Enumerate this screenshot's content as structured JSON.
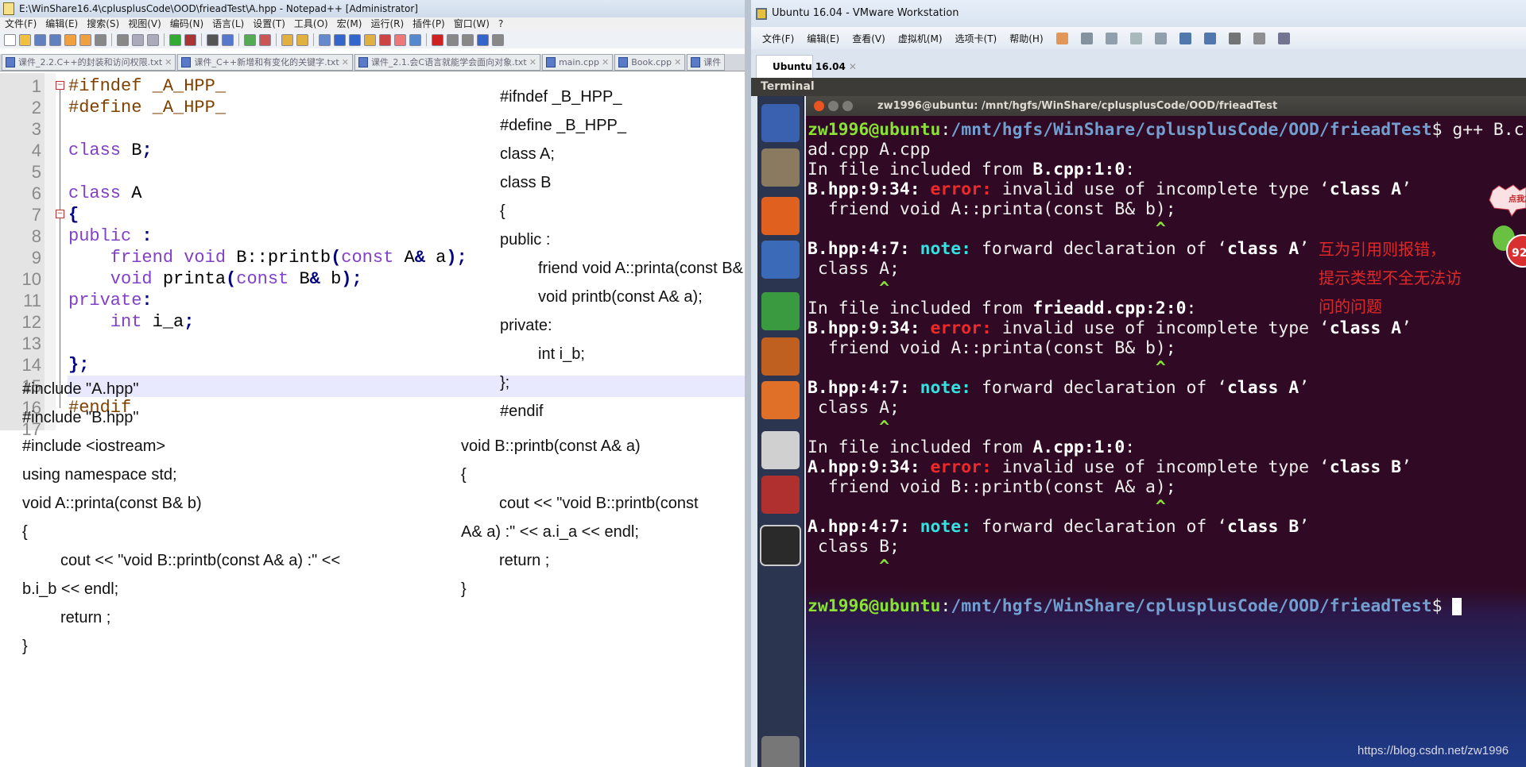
{
  "notepad": {
    "title": "E:\\WinShare16.4\\cplusplusCode\\OOD\\frieadTest\\A.hpp - Notepad++ [Administrator]",
    "menu": [
      "文件(F)",
      "编辑(E)",
      "搜索(S)",
      "视图(V)",
      "编码(N)",
      "语言(L)",
      "设置(T)",
      "工具(O)",
      "宏(M)",
      "运行(R)",
      "插件(P)",
      "窗口(W)",
      "?"
    ],
    "tabs": [
      "课件_2.2.C++的封装和访问权限.txt",
      "课件_C++新增和有变化的关键字.txt",
      "课件_2.1.会C语言就能学会面向对象.txt",
      "main.cpp",
      "Book.cpp",
      "课件"
    ],
    "close_glyph": "✕",
    "line_numbers": [
      "1",
      "2",
      "3",
      "4",
      "5",
      "6",
      "7",
      "8",
      "9",
      "10",
      "11",
      "12",
      "13",
      "14",
      "15",
      "16",
      "17"
    ],
    "code": [
      [
        {
          "t": "#ifndef _A_HPP_",
          "c": "pp"
        }
      ],
      [
        {
          "t": "#define _A_HPP_",
          "c": "pp"
        }
      ],
      [],
      [
        {
          "t": "class",
          "c": "kw"
        },
        {
          "t": " B",
          "c": "id"
        },
        {
          "t": ";",
          "c": "op"
        }
      ],
      [],
      [
        {
          "t": "class",
          "c": "kw"
        },
        {
          "t": " A",
          "c": "id"
        }
      ],
      [
        {
          "t": "{",
          "c": "op"
        }
      ],
      [
        {
          "t": "public",
          "c": "kw"
        },
        {
          "t": " :",
          "c": "op"
        }
      ],
      [
        {
          "t": "    friend void",
          "c": "kw"
        },
        {
          "t": " B::printb",
          "c": "id"
        },
        {
          "t": "(",
          "c": "op"
        },
        {
          "t": "const",
          "c": "kw"
        },
        {
          "t": " A",
          "c": "id"
        },
        {
          "t": "&",
          "c": "op"
        },
        {
          "t": " a",
          "c": "id"
        },
        {
          "t": ");",
          "c": "op"
        }
      ],
      [
        {
          "t": "    void",
          "c": "kw"
        },
        {
          "t": " printa",
          "c": "id"
        },
        {
          "t": "(",
          "c": "op"
        },
        {
          "t": "const",
          "c": "kw"
        },
        {
          "t": " B",
          "c": "id"
        },
        {
          "t": "&",
          "c": "op"
        },
        {
          "t": " b",
          "c": "id"
        },
        {
          "t": ");",
          "c": "op"
        }
      ],
      [
        {
          "t": "private",
          "c": "kw"
        },
        {
          "t": ":",
          "c": "op"
        }
      ],
      [
        {
          "t": "    int",
          "c": "kw"
        },
        {
          "t": " i_a",
          "c": "id"
        },
        {
          "t": ";",
          "c": "op"
        }
      ],
      [],
      [
        {
          "t": "};",
          "c": "op"
        }
      ],
      [],
      [
        {
          "t": "#endif",
          "c": "pp"
        }
      ],
      []
    ]
  },
  "overlay_b_hpp": [
    "#ifndef _B_HPP_",
    "#define _B_HPP_",
    "class A;",
    "class B",
    "{",
    "public :",
    "      friend void A::printa(const B& b);",
    "      void printb(const A& a);",
    "private:",
    "      int i_b;",
    "};",
    "#endif"
  ],
  "overlay_b_cpp": [
    "void B::printb(const A& a)",
    "{",
    "      cout << \"void B::printb(const",
    "A& a) :\" << a.i_a << endl;",
    "      return ;",
    "}"
  ],
  "overlay_a_cpp": [
    "#include \"A.hpp\"",
    "#include \"B.hpp\"",
    "#include <iostream>",
    "using namespace std;",
    "void A::printa(const B& b)",
    "{",
    "      cout << \"void B::printb(const A& a) :\" <<",
    "b.i_b << endl;",
    "      return ;",
    "}"
  ],
  "vmware": {
    "title": "Ubuntu 16.04 - VMware Workstation",
    "menu": [
      "文件(F)",
      "编辑(E)",
      "查看(V)",
      "虚拟机(M)",
      "选项卡(T)",
      "帮助(H)"
    ],
    "tab": "Ubuntu 16.04",
    "tab_close": "✕",
    "app_header": "Terminal",
    "launcher": [
      "ubuntu-dash",
      "files",
      "firefox",
      "libreoffice-writer",
      "libreoffice-calc",
      "libreoffice-impress",
      "software-center",
      "amazon",
      "system-settings",
      "terminal",
      "trash"
    ],
    "terminal_title": "zw1996@ubuntu: /mnt/hgfs/WinShare/cplusplusCode/OOD/frieadTest",
    "lines": [
      [
        {
          "t": "zw1996@ubuntu",
          "c": "g"
        },
        {
          "t": ":",
          "c": ""
        },
        {
          "t": "/mnt/hgfs/WinShare/cplusplusCode/OOD/frieadTest",
          "c": "b"
        },
        {
          "t": "$ g++ B.c",
          "c": ""
        }
      ],
      [
        {
          "t": "ad.cpp A.cpp",
          "c": ""
        }
      ],
      [
        {
          "t": "In file included from ",
          "c": ""
        },
        {
          "t": "B.cpp:1:0",
          "c": "w"
        },
        {
          "t": ":",
          "c": ""
        }
      ],
      [
        {
          "t": "B.hpp:9:34: ",
          "c": "w"
        },
        {
          "t": "error:",
          "c": "e"
        },
        {
          "t": " invalid use of incomplete type ‘",
          "c": ""
        },
        {
          "t": "class A",
          "c": "w"
        },
        {
          "t": "’",
          "c": ""
        }
      ],
      [
        {
          "t": "  friend void A::printa(const B& b);",
          "c": ""
        }
      ],
      [
        {
          "t": "                                  ^",
          "c": "c"
        }
      ],
      [
        {
          "t": "B.hpp:4:7: ",
          "c": "w"
        },
        {
          "t": "note:",
          "c": "n"
        },
        {
          "t": " forward declaration of ‘",
          "c": ""
        },
        {
          "t": "class A",
          "c": "w"
        },
        {
          "t": "’",
          "c": ""
        }
      ],
      [
        {
          "t": " class A;",
          "c": ""
        }
      ],
      [
        {
          "t": "       ^",
          "c": "c"
        }
      ],
      [
        {
          "t": "In file included from ",
          "c": ""
        },
        {
          "t": "frieadd.cpp:2:0",
          "c": "w"
        },
        {
          "t": ":",
          "c": ""
        }
      ],
      [
        {
          "t": "B.hpp:9:34: ",
          "c": "w"
        },
        {
          "t": "error:",
          "c": "e"
        },
        {
          "t": " invalid use of incomplete type ‘",
          "c": ""
        },
        {
          "t": "class A",
          "c": "w"
        },
        {
          "t": "’",
          "c": ""
        }
      ],
      [
        {
          "t": "  friend void A::printa(const B& b);",
          "c": ""
        }
      ],
      [
        {
          "t": "                                  ^",
          "c": "c"
        }
      ],
      [
        {
          "t": "B.hpp:4:7: ",
          "c": "w"
        },
        {
          "t": "note:",
          "c": "n"
        },
        {
          "t": " forward declaration of ‘",
          "c": ""
        },
        {
          "t": "class A",
          "c": "w"
        },
        {
          "t": "’",
          "c": ""
        }
      ],
      [
        {
          "t": " class A;",
          "c": ""
        }
      ],
      [
        {
          "t": "       ^",
          "c": "c"
        }
      ],
      [
        {
          "t": "In file included from ",
          "c": ""
        },
        {
          "t": "A.cpp:1:0",
          "c": "w"
        },
        {
          "t": ":",
          "c": ""
        }
      ],
      [
        {
          "t": "A.hpp:9:34: ",
          "c": "w"
        },
        {
          "t": "error:",
          "c": "e"
        },
        {
          "t": " invalid use of incomplete type ‘",
          "c": ""
        },
        {
          "t": "class B",
          "c": "w"
        },
        {
          "t": "’",
          "c": ""
        }
      ],
      [
        {
          "t": "  friend void B::printb(const A& a);",
          "c": ""
        }
      ],
      [
        {
          "t": "                                  ^",
          "c": "c"
        }
      ],
      [
        {
          "t": "A.hpp:4:7: ",
          "c": "w"
        },
        {
          "t": "note:",
          "c": "n"
        },
        {
          "t": " forward declaration of ‘",
          "c": ""
        },
        {
          "t": "class B",
          "c": "w"
        },
        {
          "t": "’",
          "c": ""
        }
      ],
      [
        {
          "t": " class B;",
          "c": ""
        }
      ],
      [
        {
          "t": "       ^",
          "c": "c"
        }
      ],
      [],
      [
        {
          "t": "zw1996@ubuntu",
          "c": "g"
        },
        {
          "t": ":",
          "c": ""
        },
        {
          "t": "/mnt/hgfs/WinShare/cplusplusCode/OOD/frieadTest",
          "c": "b"
        },
        {
          "t": "$ ",
          "c": ""
        }
      ]
    ]
  },
  "annotation": [
    "互为引用则报错，",
    "提示类型不全无法访",
    "问的问题"
  ],
  "badge_text": "点我加速",
  "badge_number": "92",
  "watermark": "https://blog.csdn.net/zw1996"
}
